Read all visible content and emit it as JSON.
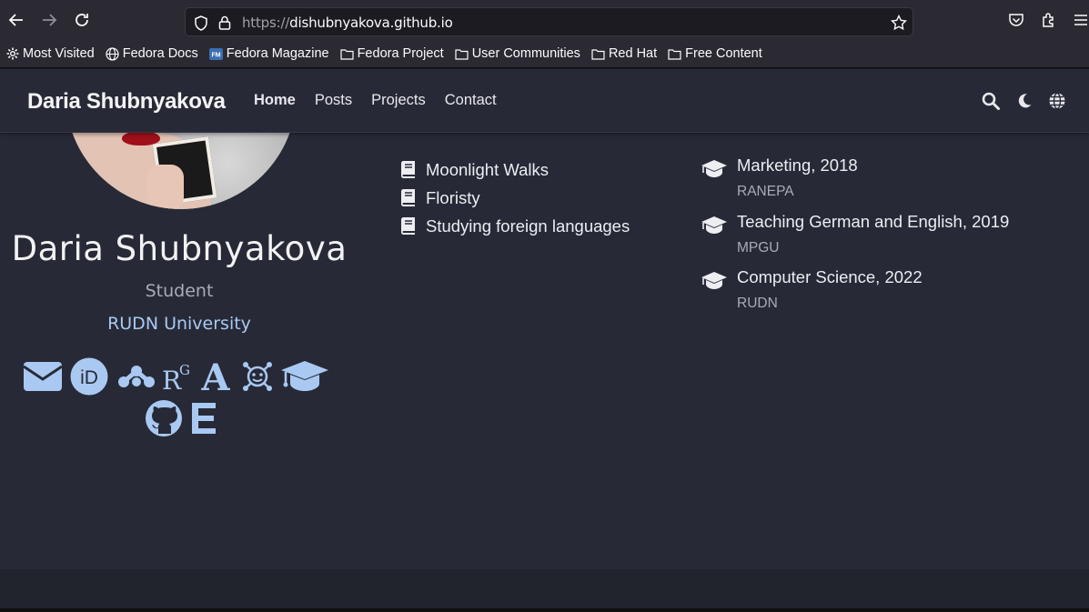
{
  "browser": {
    "url_protocol": "https://",
    "url_host": "dishubnyakova.github.io",
    "bookmarks": [
      {
        "label": "Most Visited",
        "icon": "gear-icon"
      },
      {
        "label": "Fedora Docs",
        "icon": "globe-icon"
      },
      {
        "label": "Fedora Magazine",
        "icon": "fm-icon"
      },
      {
        "label": "Fedora Project",
        "icon": "folder-icon"
      },
      {
        "label": "User Communities",
        "icon": "folder-icon"
      },
      {
        "label": "Red Hat",
        "icon": "folder-icon"
      },
      {
        "label": "Free Content",
        "icon": "folder-icon"
      }
    ]
  },
  "site": {
    "brand": "Daria Shubnyakova",
    "nav": [
      "Home",
      "Posts",
      "Projects",
      "Contact"
    ],
    "active_nav": "Home"
  },
  "profile": {
    "name": "Daria Shubnyakova",
    "role": "Student",
    "organization": "RUDN University",
    "social_icons": [
      "envelope-icon",
      "orcid-icon",
      "mendeley-icon",
      "researchgate-icon",
      "academia-icon",
      "semanticscholar-icon",
      "graduation-cap-icon",
      "github-icon",
      "e-icon"
    ]
  },
  "interests": [
    "Moonlight Walks",
    "Floristy",
    "Studying foreign languages"
  ],
  "education": [
    {
      "degree": "Marketing, 2018",
      "institution": "RANEPA"
    },
    {
      "degree": "Teaching German and English, 2019",
      "institution": "MPGU"
    },
    {
      "degree": "Computer Science, 2022",
      "institution": "RUDN"
    }
  ],
  "colors": {
    "page_bg": "#272a36",
    "accent": "#a9c9f2",
    "browser_bg": "#2b2a33"
  }
}
